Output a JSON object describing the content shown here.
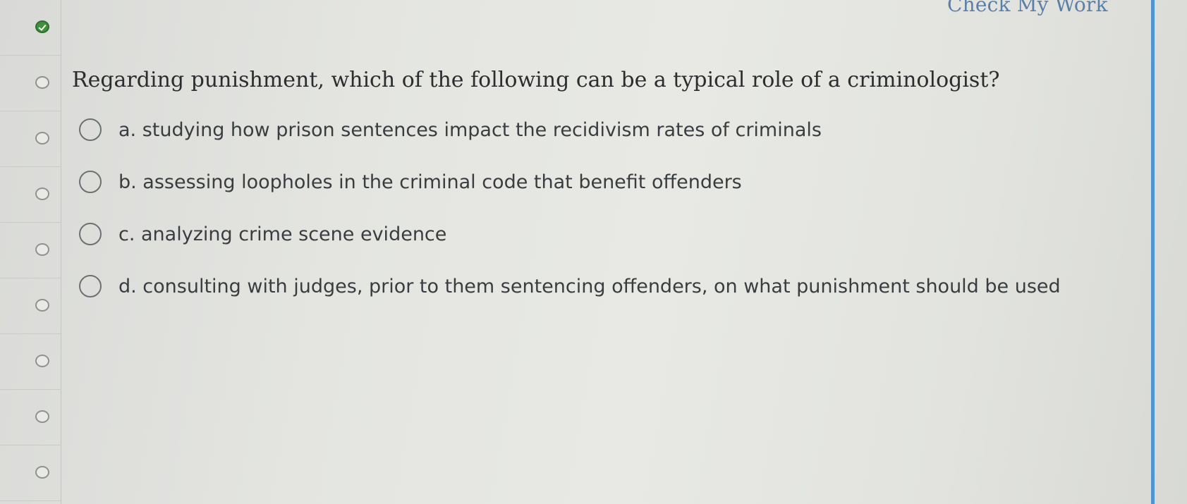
{
  "header": {
    "check_my_work_label": "Check My Work"
  },
  "nav": {
    "items": [
      {
        "status": "completed"
      },
      {
        "status": "unanswered"
      },
      {
        "status": "unanswered"
      },
      {
        "status": "unanswered"
      },
      {
        "status": "unanswered"
      },
      {
        "status": "unanswered"
      },
      {
        "status": "unanswered"
      },
      {
        "status": "unanswered"
      },
      {
        "status": "unanswered"
      }
    ]
  },
  "question": {
    "text": "Regarding punishment, which of the following can be a typical role of a criminologist?",
    "options": [
      {
        "label": "a. studying how prison sentences impact the recidivism rates of criminals",
        "selected": false
      },
      {
        "label": "b. assessing loopholes in the criminal code that benefit offenders",
        "selected": false
      },
      {
        "label": "c. analyzing crime scene evidence",
        "selected": false
      },
      {
        "label": "d. consulting with judges, prior to them sentencing offenders, on what punishment should be used",
        "selected": false
      }
    ]
  },
  "colors": {
    "accent_blue": "#4f95d6",
    "completed_green": "#3f8f3d",
    "link_blue": "#5a7fa8"
  }
}
